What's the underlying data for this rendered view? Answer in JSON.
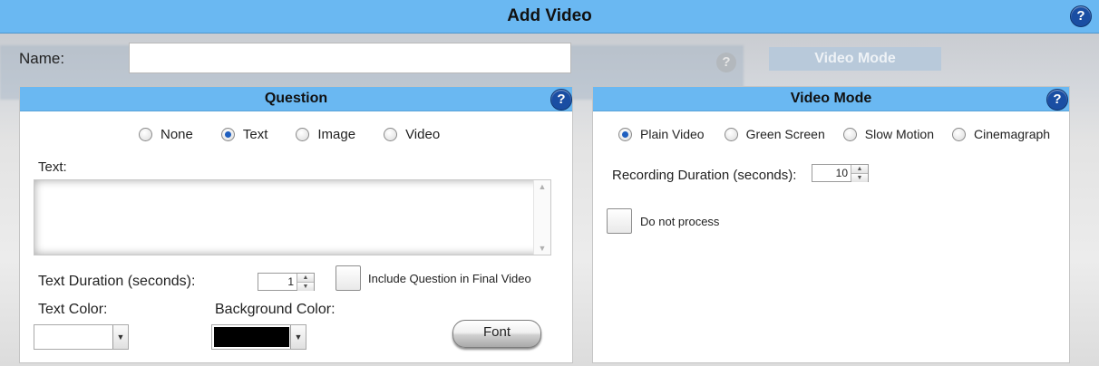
{
  "window": {
    "title": "Add Video",
    "help": "?"
  },
  "name": {
    "label": "Name:",
    "value": ""
  },
  "background": {
    "ghost_title": "Video Mode",
    "ghost_help": "?"
  },
  "question": {
    "title": "Question",
    "help": "?",
    "types": [
      {
        "label": "None",
        "selected": false
      },
      {
        "label": "Text",
        "selected": true
      },
      {
        "label": "Image",
        "selected": false
      },
      {
        "label": "Video",
        "selected": false
      }
    ],
    "text_label": "Text:",
    "text_value": "",
    "duration_label": "Text Duration (seconds):",
    "duration_value": "1",
    "include_label": "Include Question in Final Video",
    "include_checked": false,
    "text_color_label": "Text Color:",
    "text_color": "#ffffff",
    "bg_color_label": "Background Color:",
    "bg_color": "#000000",
    "font_button": "Font"
  },
  "video_mode": {
    "title": "Video Mode",
    "help": "?",
    "modes": [
      {
        "label": "Plain Video",
        "selected": true
      },
      {
        "label": "Green Screen",
        "selected": false
      },
      {
        "label": "Slow Motion",
        "selected": false
      },
      {
        "label": "Cinemagraph",
        "selected": false
      }
    ],
    "recording_label": "Recording Duration (seconds):",
    "recording_value": "10",
    "no_process_label": "Do not process",
    "no_process_checked": false
  },
  "colors": {
    "header": "#6ab8f2",
    "radio_selected": "#1f5fbf",
    "help_button": "#1a4ea3"
  }
}
